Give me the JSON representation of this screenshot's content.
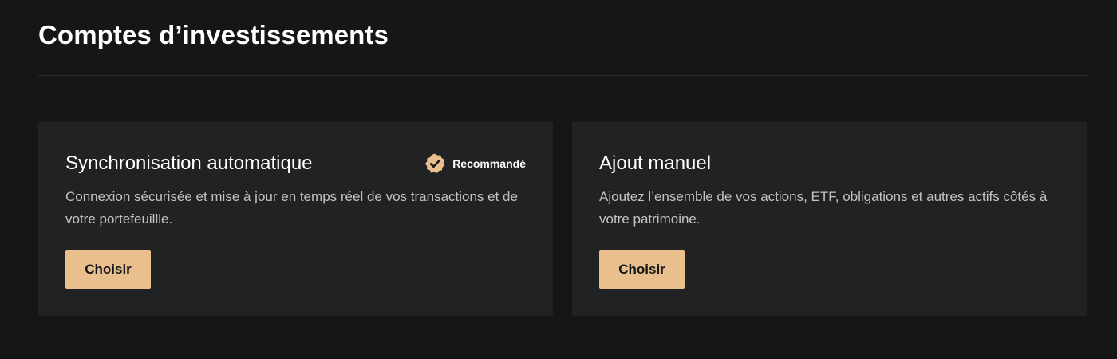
{
  "page": {
    "title": "Comptes d’investissements"
  },
  "colors": {
    "background": "#151618",
    "card": "#202224",
    "accent": "#e8bf8d",
    "text_muted": "#c3c3c5"
  },
  "cards": [
    {
      "title": "Synchronisation automatique",
      "description": "Connexion sécurisée et mise à jour en temps réel de vos transactions et de votre portefeuillle.",
      "button_label": "Choisir",
      "badge": {
        "icon": "verified-badge-icon",
        "label": "Recommandé"
      }
    },
    {
      "title": "Ajout manuel",
      "description": "Ajoutez l’ensemble de vos actions, ETF, obligations et autres actifs côtés à votre patrimoine.",
      "button_label": "Choisir"
    }
  ]
}
